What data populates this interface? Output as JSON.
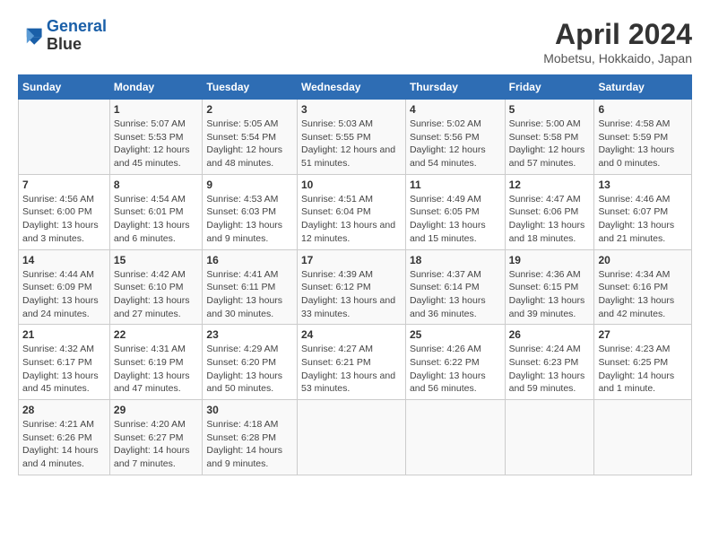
{
  "header": {
    "logo_line1": "General",
    "logo_line2": "Blue",
    "title": "April 2024",
    "subtitle": "Mobetsu, Hokkaido, Japan"
  },
  "calendar": {
    "days_of_week": [
      "Sunday",
      "Monday",
      "Tuesday",
      "Wednesday",
      "Thursday",
      "Friday",
      "Saturday"
    ],
    "weeks": [
      [
        {
          "day": "",
          "info": ""
        },
        {
          "day": "1",
          "info": "Sunrise: 5:07 AM\nSunset: 5:53 PM\nDaylight: 12 hours\nand 45 minutes."
        },
        {
          "day": "2",
          "info": "Sunrise: 5:05 AM\nSunset: 5:54 PM\nDaylight: 12 hours\nand 48 minutes."
        },
        {
          "day": "3",
          "info": "Sunrise: 5:03 AM\nSunset: 5:55 PM\nDaylight: 12 hours\nand 51 minutes."
        },
        {
          "day": "4",
          "info": "Sunrise: 5:02 AM\nSunset: 5:56 PM\nDaylight: 12 hours\nand 54 minutes."
        },
        {
          "day": "5",
          "info": "Sunrise: 5:00 AM\nSunset: 5:58 PM\nDaylight: 12 hours\nand 57 minutes."
        },
        {
          "day": "6",
          "info": "Sunrise: 4:58 AM\nSunset: 5:59 PM\nDaylight: 13 hours\nand 0 minutes."
        }
      ],
      [
        {
          "day": "7",
          "info": "Sunrise: 4:56 AM\nSunset: 6:00 PM\nDaylight: 13 hours\nand 3 minutes."
        },
        {
          "day": "8",
          "info": "Sunrise: 4:54 AM\nSunset: 6:01 PM\nDaylight: 13 hours\nand 6 minutes."
        },
        {
          "day": "9",
          "info": "Sunrise: 4:53 AM\nSunset: 6:03 PM\nDaylight: 13 hours\nand 9 minutes."
        },
        {
          "day": "10",
          "info": "Sunrise: 4:51 AM\nSunset: 6:04 PM\nDaylight: 13 hours\nand 12 minutes."
        },
        {
          "day": "11",
          "info": "Sunrise: 4:49 AM\nSunset: 6:05 PM\nDaylight: 13 hours\nand 15 minutes."
        },
        {
          "day": "12",
          "info": "Sunrise: 4:47 AM\nSunset: 6:06 PM\nDaylight: 13 hours\nand 18 minutes."
        },
        {
          "day": "13",
          "info": "Sunrise: 4:46 AM\nSunset: 6:07 PM\nDaylight: 13 hours\nand 21 minutes."
        }
      ],
      [
        {
          "day": "14",
          "info": "Sunrise: 4:44 AM\nSunset: 6:09 PM\nDaylight: 13 hours\nand 24 minutes."
        },
        {
          "day": "15",
          "info": "Sunrise: 4:42 AM\nSunset: 6:10 PM\nDaylight: 13 hours\nand 27 minutes."
        },
        {
          "day": "16",
          "info": "Sunrise: 4:41 AM\nSunset: 6:11 PM\nDaylight: 13 hours\nand 30 minutes."
        },
        {
          "day": "17",
          "info": "Sunrise: 4:39 AM\nSunset: 6:12 PM\nDaylight: 13 hours\nand 33 minutes."
        },
        {
          "day": "18",
          "info": "Sunrise: 4:37 AM\nSunset: 6:14 PM\nDaylight: 13 hours\nand 36 minutes."
        },
        {
          "day": "19",
          "info": "Sunrise: 4:36 AM\nSunset: 6:15 PM\nDaylight: 13 hours\nand 39 minutes."
        },
        {
          "day": "20",
          "info": "Sunrise: 4:34 AM\nSunset: 6:16 PM\nDaylight: 13 hours\nand 42 minutes."
        }
      ],
      [
        {
          "day": "21",
          "info": "Sunrise: 4:32 AM\nSunset: 6:17 PM\nDaylight: 13 hours\nand 45 minutes."
        },
        {
          "day": "22",
          "info": "Sunrise: 4:31 AM\nSunset: 6:19 PM\nDaylight: 13 hours\nand 47 minutes."
        },
        {
          "day": "23",
          "info": "Sunrise: 4:29 AM\nSunset: 6:20 PM\nDaylight: 13 hours\nand 50 minutes."
        },
        {
          "day": "24",
          "info": "Sunrise: 4:27 AM\nSunset: 6:21 PM\nDaylight: 13 hours\nand 53 minutes."
        },
        {
          "day": "25",
          "info": "Sunrise: 4:26 AM\nSunset: 6:22 PM\nDaylight: 13 hours\nand 56 minutes."
        },
        {
          "day": "26",
          "info": "Sunrise: 4:24 AM\nSunset: 6:23 PM\nDaylight: 13 hours\nand 59 minutes."
        },
        {
          "day": "27",
          "info": "Sunrise: 4:23 AM\nSunset: 6:25 PM\nDaylight: 14 hours\nand 1 minute."
        }
      ],
      [
        {
          "day": "28",
          "info": "Sunrise: 4:21 AM\nSunset: 6:26 PM\nDaylight: 14 hours\nand 4 minutes."
        },
        {
          "day": "29",
          "info": "Sunrise: 4:20 AM\nSunset: 6:27 PM\nDaylight: 14 hours\nand 7 minutes."
        },
        {
          "day": "30",
          "info": "Sunrise: 4:18 AM\nSunset: 6:28 PM\nDaylight: 14 hours\nand 9 minutes."
        },
        {
          "day": "",
          "info": ""
        },
        {
          "day": "",
          "info": ""
        },
        {
          "day": "",
          "info": ""
        },
        {
          "day": "",
          "info": ""
        }
      ]
    ]
  }
}
